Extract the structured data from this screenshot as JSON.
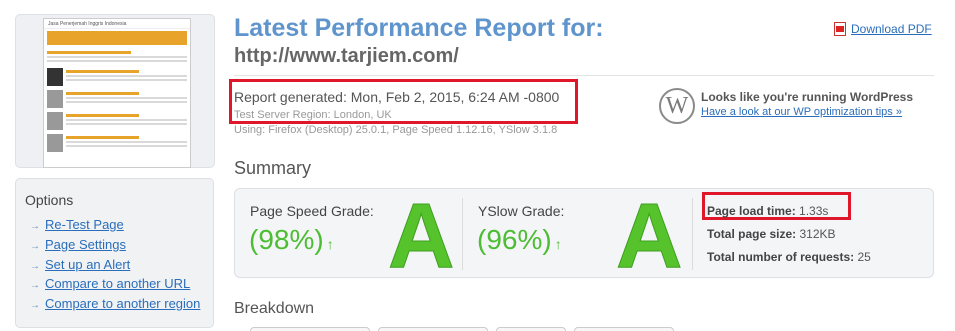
{
  "header": {
    "title": "Latest Performance Report for:",
    "url": "http://www.tarjiem.com/",
    "download_pdf": "Download PDF"
  },
  "report": {
    "generated": "Report generated: Mon, Feb 2, 2015, 6:24 AM -0800",
    "server_region": "Test Server Region: London, UK",
    "using": "Using: Firefox (Desktop) 25.0.1, Page Speed 1.12.16, YSlow 3.1.8"
  },
  "wordpress": {
    "title": "Looks like you're running WordPress",
    "link": "Have a look at our WP optimization tips »"
  },
  "thumbnail": {
    "site_title": "Jasa Penerjemah Inggris Indonesia"
  },
  "options": {
    "heading": "Options",
    "items": [
      {
        "label": "Re-Test Page"
      },
      {
        "label": "Page Settings"
      },
      {
        "label": "Set up an Alert"
      },
      {
        "label": "Compare to another URL"
      },
      {
        "label": "Compare to another region"
      }
    ]
  },
  "summary": {
    "heading": "Summary",
    "pagespeed": {
      "label": "Page Speed Grade:",
      "value": "(98%)",
      "grade": "A",
      "trend": "↑"
    },
    "yslow": {
      "label": "YSlow Grade:",
      "value": "(96%)",
      "grade": "A",
      "trend": "↑"
    },
    "load_time_label": "Page load time:",
    "load_time_value": "1.33s",
    "page_size_label": "Total page size:",
    "page_size_value": "312KB",
    "requests_label": "Total number of requests:",
    "requests_value": "25"
  },
  "breakdown": {
    "heading": "Breakdown"
  },
  "colors": {
    "title": "#5f95cc",
    "grade_green": "#4dbd33",
    "highlight_red": "#e0162b",
    "link": "#2a6ebb"
  }
}
